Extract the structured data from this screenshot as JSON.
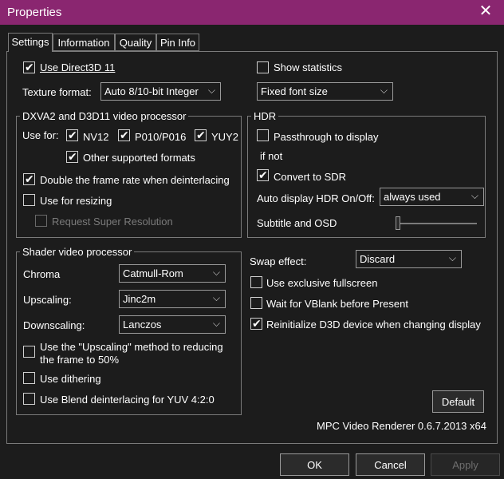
{
  "window": {
    "title": "Properties",
    "close": "✕"
  },
  "tabs": [
    "Settings",
    "Information",
    "Quality",
    "Pin Info"
  ],
  "settings": {
    "use_d3d11": {
      "label": "Use Direct3D 11",
      "checked": true
    },
    "show_statistics": {
      "label": "Show statistics",
      "checked": false
    },
    "texture_format": {
      "label": "Texture format:",
      "value": "Auto 8/10-bit Integer"
    },
    "font_size": {
      "value": "Fixed font size"
    },
    "dxva": {
      "title": "DXVA2 and D3D11 video processor",
      "use_for_label": "Use for:",
      "nv12": {
        "label": "NV12",
        "checked": true
      },
      "p010": {
        "label": "P010/P016",
        "checked": true
      },
      "yuy2": {
        "label": "YUY2",
        "checked": true
      },
      "other_formats": {
        "label": "Other supported formats",
        "checked": true
      },
      "double_rate": {
        "label": "Double the frame rate when deinterlacing",
        "checked": true
      },
      "resizing": {
        "label": "Use for resizing",
        "checked": false
      },
      "super_res": {
        "label": "Request Super Resolution",
        "checked": false
      }
    },
    "hdr": {
      "title": "HDR",
      "passthrough": {
        "label": "Passthrough to display",
        "checked": false
      },
      "if_not": "if not",
      "convert_sdr": {
        "label": "Convert to SDR",
        "checked": true
      },
      "auto_display_label": "Auto display HDR On/Off:",
      "auto_display_value": "always used",
      "subtitle_osd": "Subtitle and OSD",
      "subtitle_level": 0
    },
    "shader": {
      "title": "Shader video processor",
      "chroma": {
        "label": "Chroma",
        "value": "Catmull-Rom"
      },
      "upscaling": {
        "label": "Upscaling:",
        "value": "Jinc2m"
      },
      "downscaling": {
        "label": "Downscaling:",
        "value": "Lanczos"
      },
      "reduce": {
        "line1": "Use the \"Upscaling\" method to reducing",
        "line2": "the frame to 50%",
        "checked": false
      },
      "dithering": {
        "label": "Use dithering",
        "checked": false
      },
      "blend": {
        "label": "Use Blend deinterlacing for YUV 4:2:0",
        "checked": false
      }
    },
    "swap_effect": {
      "label": "Swap effect:",
      "value": "Discard"
    },
    "exclusive": {
      "label": "Use exclusive fullscreen",
      "checked": false
    },
    "vblank": {
      "label": "Wait for VBlank before Present",
      "checked": false
    },
    "reinit": {
      "label": "Reinitialize D3D device when changing display",
      "checked": true
    },
    "default_button": "Default",
    "version": "MPC Video Renderer 0.6.7.2013 x64"
  },
  "buttons": {
    "ok": "OK",
    "cancel": "Cancel",
    "apply": "Apply"
  },
  "icons": {
    "check": "✔",
    "chevron": "⌵"
  },
  "colors": {
    "titlebar": "#8a2670",
    "background": "#1c1c1c",
    "border": "#7a7a7a"
  }
}
